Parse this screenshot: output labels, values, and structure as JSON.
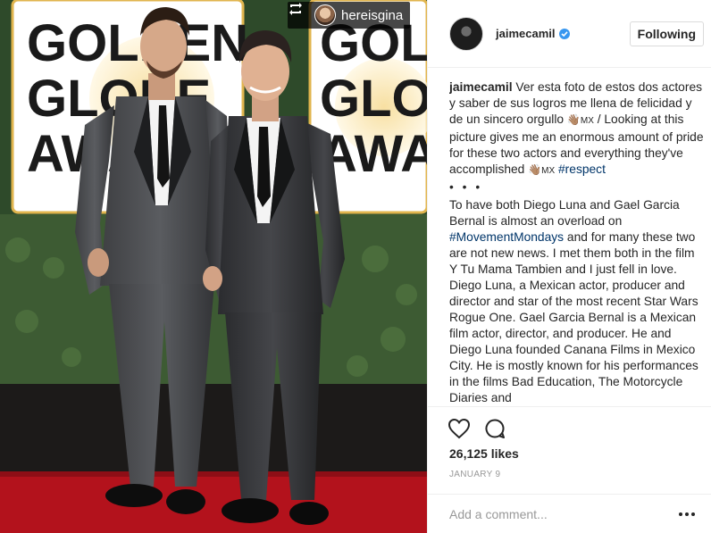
{
  "photo": {
    "repost_user": "hereisgina",
    "backdrop_text_left": [
      "GOLDEN",
      "GLOBE",
      "AWA"
    ],
    "backdrop_text_right": [
      "GOLDEN",
      "GLOBE",
      "AWARDS"
    ]
  },
  "header": {
    "username": "jaimecamil",
    "follow_label": "Following"
  },
  "caption": {
    "username": "jaimecamil",
    "text_1": "Ver esta foto de estos dos actores y saber de sus logros me llena de felicidad y de un sincero orgullo ",
    "emoji_1": "👋🏽",
    "mx_1": "MX",
    "text_2": " / Looking at this picture gives me an enormous amount of pride for these two actors and everything they've accomplished ",
    "emoji_2": "👋🏽",
    "mx_2": "MX",
    "hashtag_1": "#respect",
    "dots": "• • •",
    "text_3": "To have both Diego Luna and Gael Garcia Bernal is almost an overload on ",
    "hashtag_2": "#MovementMondays",
    "text_4": " and for many these two are not new news. I met them both in the film Y Tu Mama Tambien and I just fell in love. Diego Luna, a Mexican actor, producer and director and star of the most recent Star Wars Rogue One. Gael Garcia Bernal is a Mexican film actor, director, and producer. He and Diego Luna founded Canana Films in Mexico City. He is mostly known for his performances in the films Bad Education, The Motorcycle Diaries and"
  },
  "stats": {
    "likes": "26,125 likes",
    "date": "JANUARY 9"
  },
  "comment": {
    "placeholder": "Add a comment..."
  },
  "colors": {
    "verified": "#3897f0",
    "hashtag": "#003569",
    "carpet": "#b3121c",
    "backdrop_gold": "#d8a640"
  },
  "icons": [
    "repost-icon",
    "verified-icon",
    "heart-icon",
    "comment-icon",
    "more-options-icon"
  ]
}
